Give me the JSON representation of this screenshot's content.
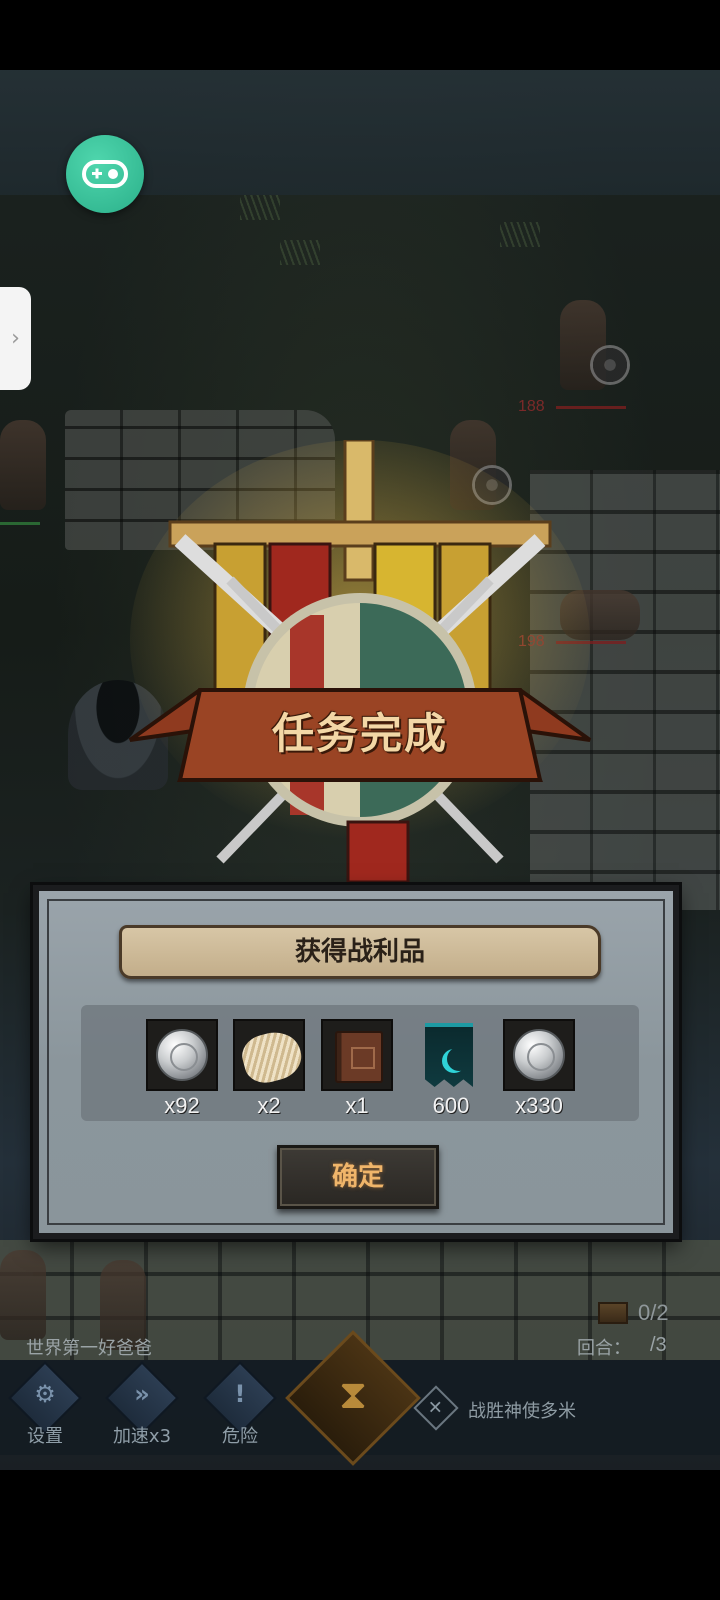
{
  "emblem": {
    "title": "任务完成"
  },
  "loot_panel": {
    "header": "获得战利品",
    "items": [
      {
        "icon": "silver-coin-icon",
        "quantity": "x92"
      },
      {
        "icon": "fur-pelt-icon",
        "quantity": "x2"
      },
      {
        "icon": "leather-book-icon",
        "quantity": "x1"
      },
      {
        "icon": "teal-banner-icon",
        "quantity": "600"
      },
      {
        "icon": "silver-coin-icon",
        "quantity": "x330"
      }
    ],
    "confirm_label": "确定"
  },
  "scene": {
    "enemy_hp": [
      "188",
      "198"
    ]
  },
  "hud": {
    "player_name": "世界第一好爸爸",
    "chest_counter": "0/2",
    "round_label": "回合：",
    "round_value": "/3",
    "buttons": [
      {
        "label": "设置",
        "icon": "gear-icon"
      },
      {
        "label": "加速x3",
        "icon": "fast-forward-icon"
      },
      {
        "label": "危险",
        "icon": "exclamation-icon"
      }
    ],
    "hourglass_icon": "hourglass-icon",
    "victory_condition": "战胜神使多米"
  },
  "overlay": {
    "gamepad_icon": "gamepad-icon",
    "side_tab_icon": "chevron-right-icon"
  },
  "colors": {
    "title_text": "#f3d7a6",
    "confirm_text": "#f0b56a",
    "gamepad_bg": "#2bb08a",
    "panel_bg": "#8b969c"
  }
}
